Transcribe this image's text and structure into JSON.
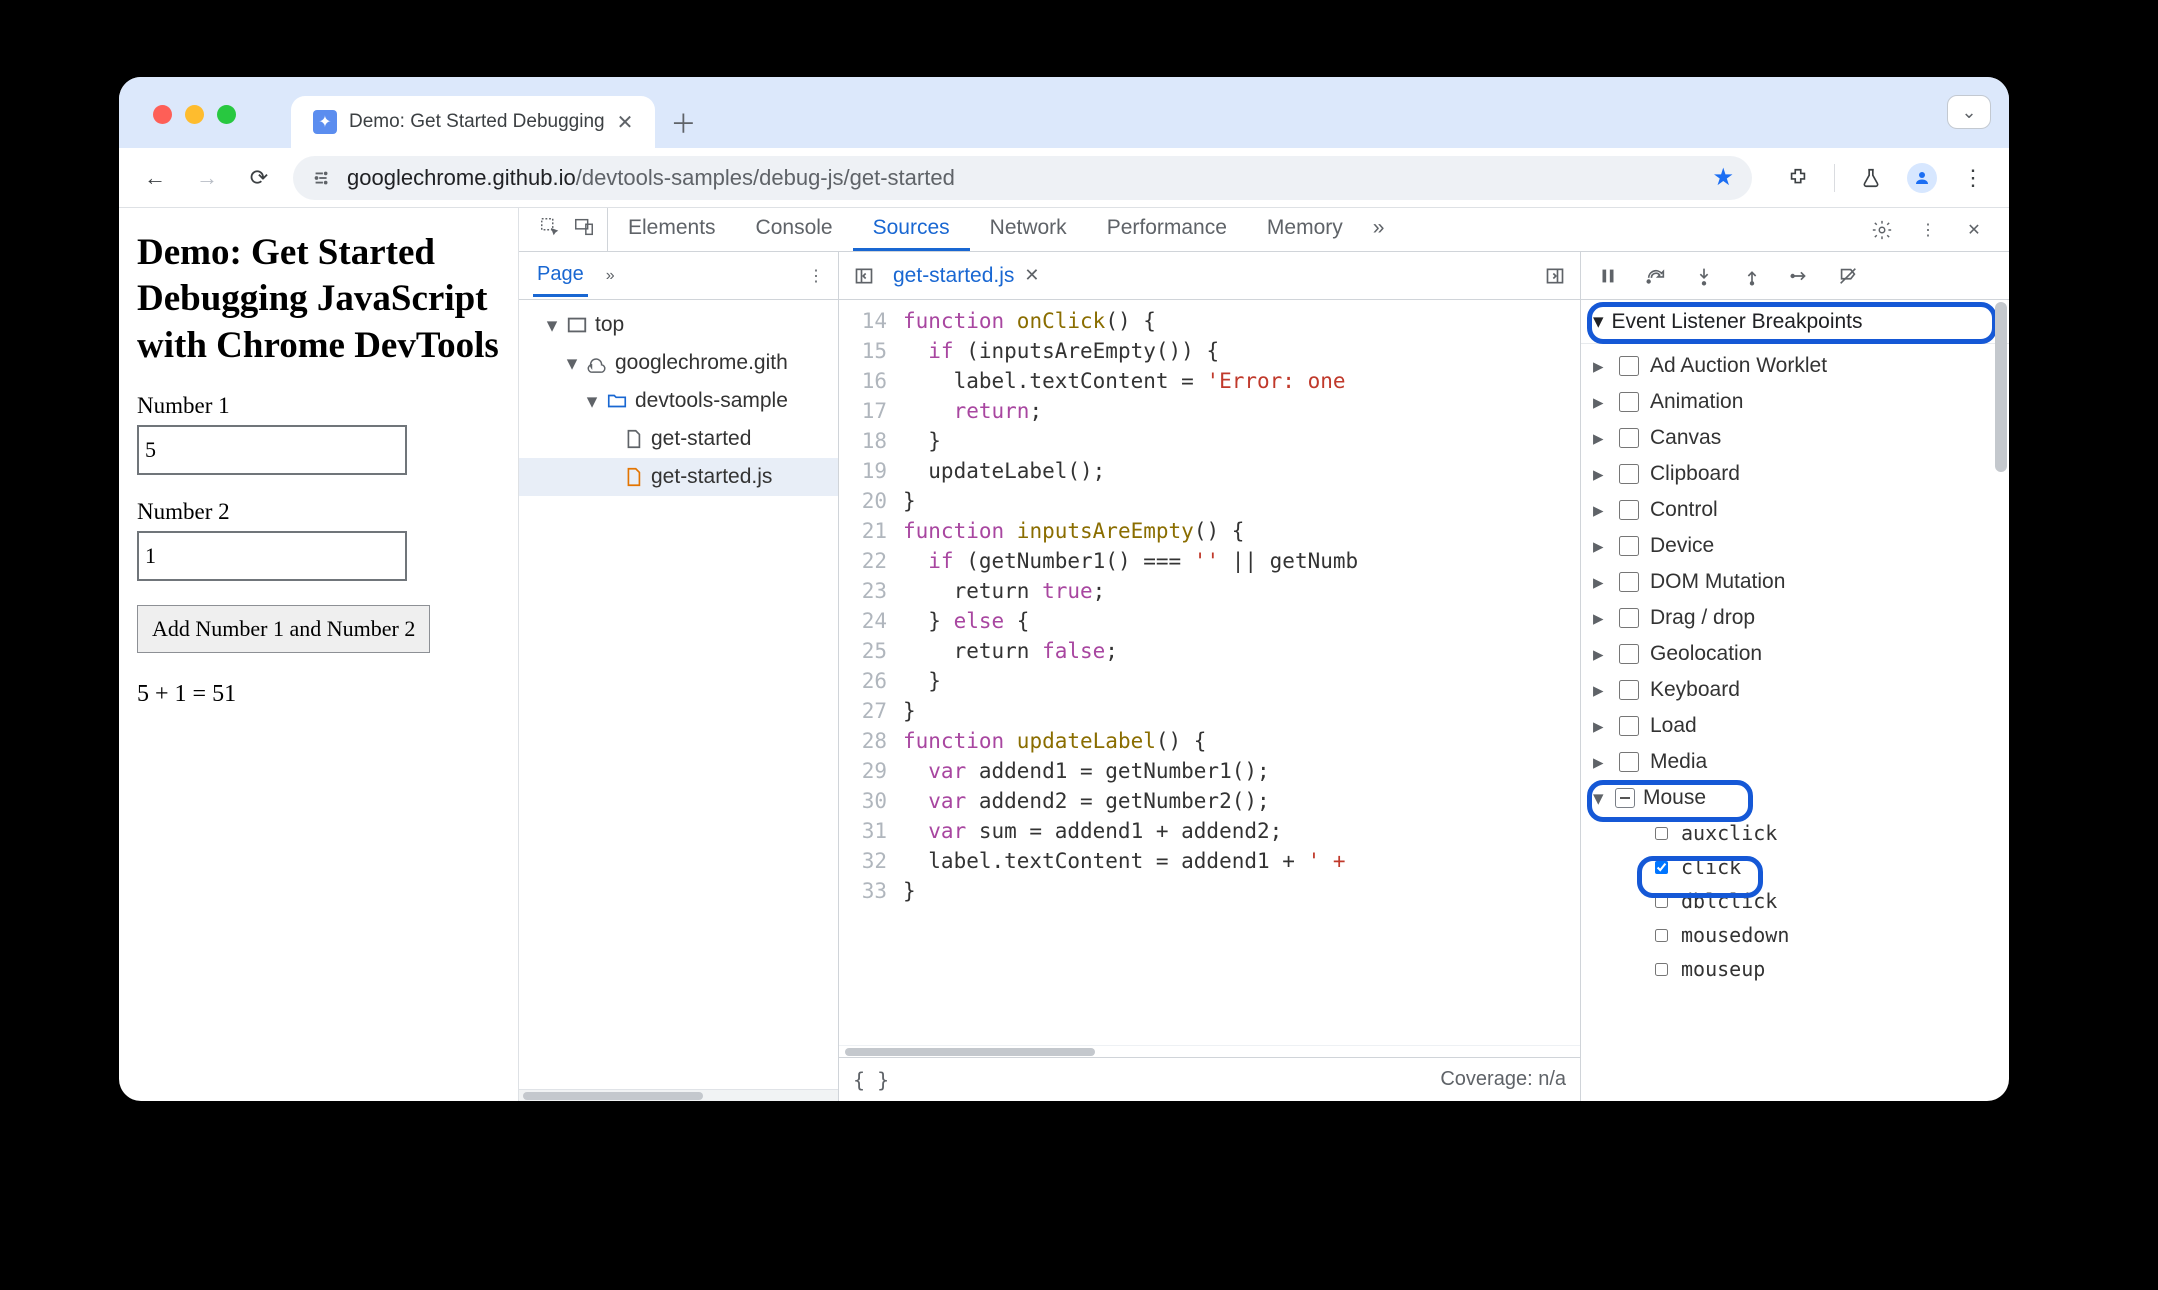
{
  "browser": {
    "tab_title": "Demo: Get Started Debugging",
    "host": "googlechrome.github.io",
    "path": "/devtools-samples/debug-js/get-started"
  },
  "page": {
    "heading": "Demo: Get Started Debugging JavaScript with Chrome DevTools",
    "label1": "Number 1",
    "value1": "5",
    "label2": "Number 2",
    "value2": "1",
    "button": "Add Number 1 and Number 2",
    "result": "5 + 1 = 51"
  },
  "devtools": {
    "tabs": [
      "Elements",
      "Console",
      "Sources",
      "Network",
      "Performance",
      "Memory"
    ],
    "active_tab": "Sources",
    "navigator": {
      "tab": "Page",
      "tree": {
        "top": "top",
        "origin": "googlechrome.gith",
        "folder": "devtools-sample",
        "files": [
          "get-started",
          "get-started.js"
        ],
        "selected": "get-started.js"
      }
    },
    "editor": {
      "filename": "get-started.js",
      "first_line": 14,
      "coverage": "Coverage: n/a",
      "line14a": "function",
      "line14b": " onClick",
      "line14c": "() {",
      "line15a": "  if",
      "line15b": " (inputsAreEmpty()) {",
      "line16a": "    label.textContent = ",
      "line16b": "'Error: one",
      "line17a": "    return",
      "line17b": ";",
      "line18": "  }",
      "line19": "  updateLabel();",
      "line20": "}",
      "line21a": "function",
      "line21b": " inputsAreEmpty",
      "line21c": "() {",
      "line22a": "  if",
      "line22b": " (getNumber1() === ",
      "line22c": "''",
      "line22d": " || getNumb",
      "line23a": "    return ",
      "line23b": "true",
      "line23c": ";",
      "line24a": "  } ",
      "line24b": "else",
      "line24c": " {",
      "line25a": "    return ",
      "line25b": "false",
      "line25c": ";",
      "line26": "  }",
      "line27": "}",
      "line28a": "function",
      "line28b": " updateLabel",
      "line28c": "() {",
      "line29a": "  var",
      "line29b": " addend1 = getNumber1();",
      "line30a": "  var",
      "line30b": " addend2 = getNumber2();",
      "line31a": "  var",
      "line31b": " sum = addend1 + addend2;",
      "line32a": "  label.textContent = addend1 + ",
      "line32b": "' +",
      "line33": "}"
    },
    "breakpoints": {
      "section_title": "Event Listener Breakpoints",
      "categories": [
        "Ad Auction Worklet",
        "Animation",
        "Canvas",
        "Clipboard",
        "Control",
        "Device",
        "DOM Mutation",
        "Drag / drop",
        "Geolocation",
        "Keyboard",
        "Load",
        "Media"
      ],
      "mouse_label": "Mouse",
      "mouse_events": [
        {
          "name": "auxclick",
          "checked": false
        },
        {
          "name": "click",
          "checked": true
        },
        {
          "name": "dblclick",
          "checked": false
        },
        {
          "name": "mousedown",
          "checked": false
        },
        {
          "name": "mouseup",
          "checked": false
        }
      ]
    }
  }
}
